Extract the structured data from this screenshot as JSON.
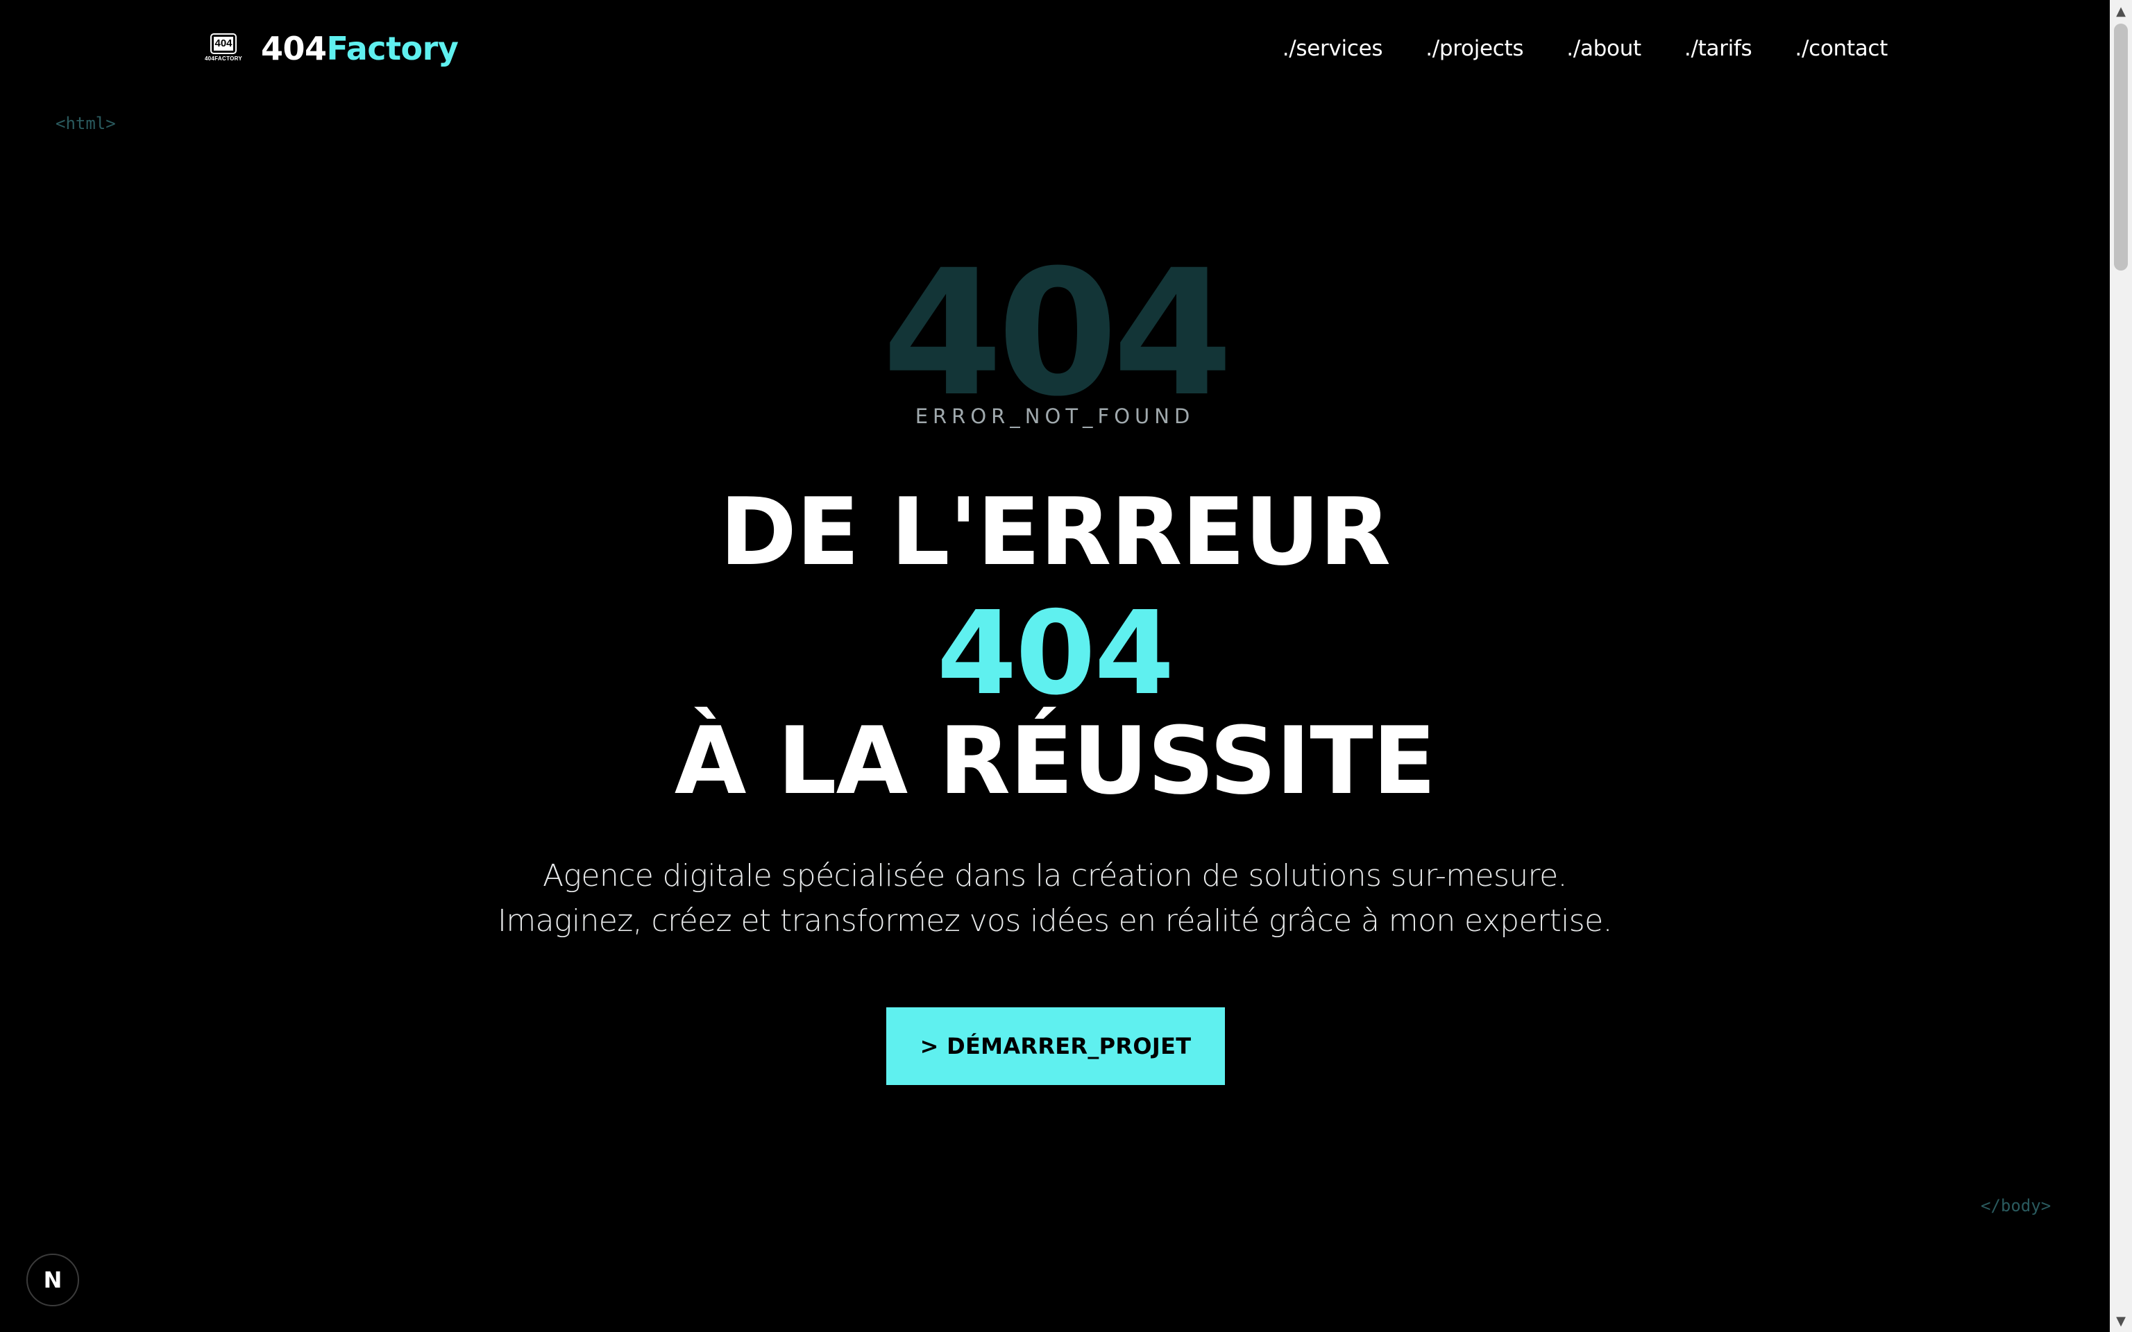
{
  "header": {
    "logo_badge": "404",
    "logo_small": "404FACTORY",
    "brand_part1": "404",
    "brand_part2": "Factory",
    "nav": [
      {
        "label": "./services"
      },
      {
        "label": "./projects"
      },
      {
        "label": "./about"
      },
      {
        "label": "./tarifs"
      },
      {
        "label": "./contact"
      }
    ]
  },
  "tags": {
    "open": "<html>",
    "close": "</body>"
  },
  "hero": {
    "big_code": "404",
    "error_label": "ERROR_NOT_FOUND",
    "title_line1": "DE L'ERREUR",
    "title_line2": "404",
    "title_line3": "À LA RÉUSSITE",
    "desc_line1": "Agence digitale spécialisée dans la création de solutions sur-mesure.",
    "desc_line2": "Imaginez, créez et transformez vos idées en réalité grâce à mon expertise.",
    "cta_label": "> DÉMARRER_PROJET"
  },
  "dev_badge": "N",
  "colors": {
    "accent": "#5ff0ef",
    "background": "#000000",
    "dim_code": "#133537"
  },
  "icons": {
    "scroll_up": "triangle-up",
    "scroll_down": "triangle-down"
  }
}
